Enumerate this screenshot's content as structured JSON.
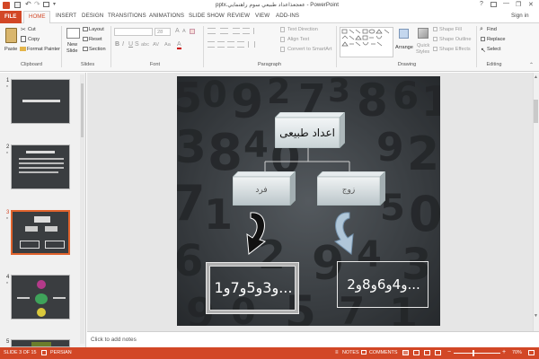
{
  "titlebar": {
    "title": "pptx.ععجعذاعداد طبيعي سوم راهنمايي - PowerPoint",
    "help": "?",
    "minimize": "—",
    "restore": "❐",
    "close": "✕"
  },
  "tabs": {
    "file": "FILE",
    "home": "HOME",
    "insert": "INSERT",
    "design": "DESIGN",
    "transitions": "TRANSITIONS",
    "animations": "ANIMATIONS",
    "slideshow": "SLIDE SHOW",
    "review": "REVIEW",
    "view": "VIEW",
    "addins": "ADD-INS",
    "signin": "Sign in"
  },
  "clipboard": {
    "paste": "Paste",
    "cut": "Cut",
    "copy": "Copy",
    "format_painter": "Format Painter",
    "label": "Clipboard"
  },
  "slides_group": {
    "new_slide": "New",
    "new_slide2": "Slide",
    "layout": "Layout",
    "reset": "Reset",
    "section": "Section",
    "label": "Slides"
  },
  "font_group": {
    "font_size": "28",
    "bold": "B",
    "italic": "I",
    "underline": "U",
    "strike": "S",
    "shadow": "abc",
    "spacing": "AV",
    "case": "Aa",
    "font_color": "A",
    "grow": "A",
    "shrink": "A",
    "label": "Font"
  },
  "paragraph_group": {
    "text_direction": "Text Direction",
    "align_text": "Align Text",
    "smartart": "Convert to SmartArt",
    "label": "Paragraph"
  },
  "drawing_group": {
    "arrange": "Arrange",
    "quick_styles": "Quick",
    "quick_styles2": "Styles",
    "shape_fill": "Shape Fill",
    "shape_outline": "Shape Outline",
    "shape_effects": "Shape Effects",
    "label": "Drawing"
  },
  "editing_group": {
    "find": "Find",
    "replace": "Replace",
    "select": "Select",
    "label": "Editing"
  },
  "thumbnails": [
    {
      "num": "1",
      "star": "*"
    },
    {
      "num": "2",
      "star": "*"
    },
    {
      "num": "3",
      "star": "*"
    },
    {
      "num": "4",
      "star": "*"
    },
    {
      "num": "5",
      "star": ""
    }
  ],
  "slide": {
    "top_box": "اعداد طبیعی",
    "left_box": "فرد",
    "right_box": "زوج",
    "left_sequence": "1و3و5و7و...",
    "right_sequence": "2و4و6و8و..."
  },
  "notes_placeholder": "Click to add notes",
  "status": {
    "slide_info": "SLIDE 3 OF 15",
    "language": "PERSIAN",
    "notes": "NOTES",
    "comments": "COMMENTS",
    "zoom": "70%"
  },
  "colors": {
    "accent": "#d24726",
    "tab_active": "#d24726"
  }
}
